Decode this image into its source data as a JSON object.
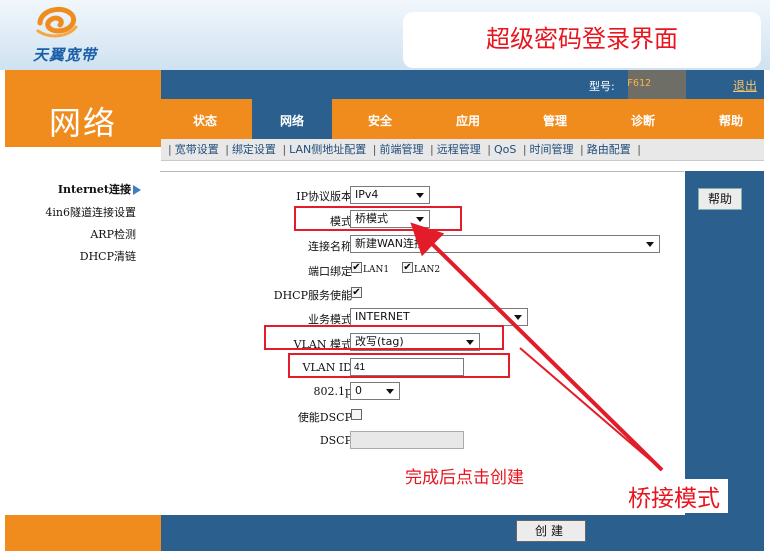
{
  "header": {
    "logo_text": "天翼宽带",
    "callout": "超级密码登录界面"
  },
  "section_title": "网络",
  "model": {
    "label": "型号:",
    "value": "F612",
    "logout": "退出"
  },
  "tabs": [
    {
      "label": "状态"
    },
    {
      "label": "网络"
    },
    {
      "label": "安全"
    },
    {
      "label": "应用"
    },
    {
      "label": "管理"
    },
    {
      "label": "诊断"
    },
    {
      "label": "帮助"
    }
  ],
  "subnav": [
    "宽带设置",
    "绑定设置",
    "LAN侧地址配置",
    "前端管理",
    "远程管理",
    "QoS",
    "时间管理",
    "路由配置"
  ],
  "left_menu": [
    {
      "label": "Internet连接"
    },
    {
      "label": "4in6隧道连接设置"
    },
    {
      "label": "ARP检测"
    },
    {
      "label": "DHCP清链"
    }
  ],
  "form": {
    "ip_version_label": "IP协议版本",
    "ip_version_value": "IPv4",
    "mode_label": "模式",
    "mode_value": "桥模式",
    "conn_name_label": "连接名称",
    "conn_name_value": "新建WAN连接",
    "port_bind_label": "端口绑定",
    "lan1": "LAN1",
    "lan2": "LAN2",
    "dhcp_label": "DHCP服务使能",
    "service_mode_label": "业务模式",
    "service_mode_value": "INTERNET",
    "vlan_mode_label": "VLAN 模式",
    "vlan_mode_value": "改写(tag)",
    "vlan_id_label": "VLAN ID",
    "vlan_id_value": "41",
    "p8021_label": "802.1p",
    "p8021_value": "0",
    "dscp_enable_label": "使能DSCP",
    "dscp_label": "DSCP"
  },
  "help_button": "帮助",
  "create_button": "创建",
  "annotations": {
    "hint": "完成后点击创建",
    "bridge": "桥接模式",
    "highlight_color": "#e21c28"
  },
  "colors": {
    "orange": "#f08c1e",
    "blue": "#2a5f8e",
    "red": "#e8141e"
  }
}
